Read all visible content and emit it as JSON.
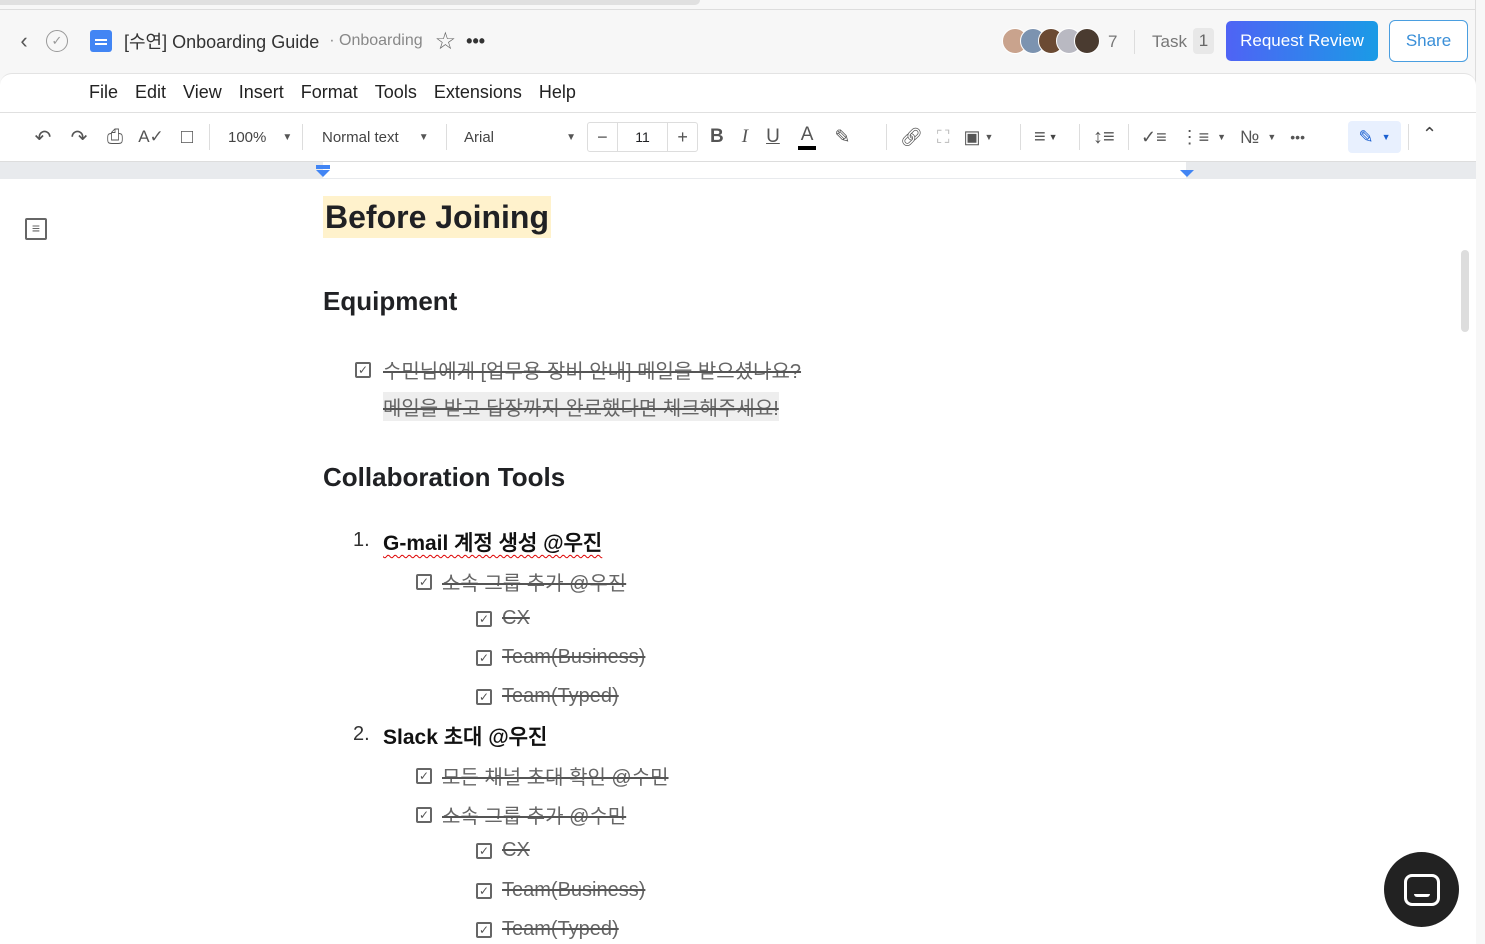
{
  "header": {
    "title": "[수연] Onboarding Guide",
    "breadcrumb": "· Onboarding",
    "collaborator_count": "7",
    "task_label": "Task",
    "task_count": "1",
    "request_review": "Request Review",
    "share": "Share",
    "accent": "#4f63f5"
  },
  "menu": [
    "File",
    "Edit",
    "View",
    "Insert",
    "Format",
    "Tools",
    "Extensions",
    "Help"
  ],
  "toolbar": {
    "zoom": "100%",
    "style": "Normal text",
    "font": "Arial",
    "font_size": "11"
  },
  "doc": {
    "title": "Before Joining",
    "equipment_heading": "Equipment",
    "equipment_items": [
      {
        "text": "수민님에게 [업무용 장비 안내] 메일을 받으셨나요?",
        "checked": true
      },
      {
        "text": "메일을 받고 답장까지 완료했다면 체크해주세요!"
      }
    ],
    "collab_heading": "Collaboration Tools",
    "list": [
      {
        "num": "1.",
        "title": "G-mail 계정 생성 @우진",
        "subs": [
          {
            "text": "소속 그룹 추가 @우진",
            "checked": true,
            "level": 1
          },
          {
            "text": "CX",
            "checked": true,
            "level": 2
          },
          {
            "text": "Team(Business)",
            "checked": true,
            "level": 2
          },
          {
            "text": "Team(Typed)",
            "checked": true,
            "level": 2
          }
        ]
      },
      {
        "num": "2.",
        "title": "Slack 초대 @우진",
        "subs": [
          {
            "text": "모든 채널 초대 확인 @수민",
            "checked": true,
            "level": 1
          },
          {
            "text": "소속 그룹 추가 @수민",
            "checked": true,
            "level": 1
          },
          {
            "text": "CX",
            "checked": true,
            "level": 2
          },
          {
            "text": "Team(Business)",
            "checked": true,
            "level": 2
          },
          {
            "text": "Team(Typed)",
            "checked": true,
            "level": 2
          }
        ]
      }
    ]
  }
}
